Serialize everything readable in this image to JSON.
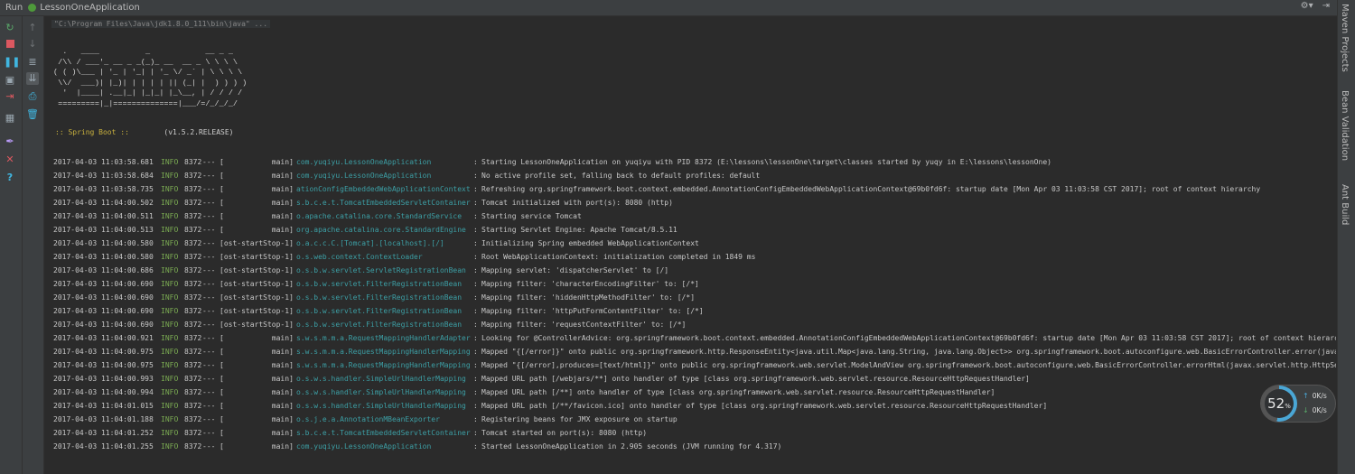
{
  "title_bar": {
    "run_label": "Run",
    "app_name": "LessonOneApplication"
  },
  "right_tabs": [
    "Maven Projects",
    "Bean Validation",
    "Ant Build"
  ],
  "command_line": "\"C:\\Program Files\\Java\\jdk1.8.0_111\\bin\\java\" ...",
  "banner": "  .   ____          _            __ _ _\n /\\\\ / ___'_ __ _ _(_)_ __  __ _ \\ \\ \\ \\\n( ( )\\___ | '_ | '_| | '_ \\/ _` | \\ \\ \\ \\\n \\\\/  ___)| |_)| | | | | || (_| |  ) ) ) )\n  '  |____| .__|_| |_|_| |_\\__, | / / / /\n =========|_|==============|___/=/_/_/_/",
  "spring_boot": {
    "label": ":: Spring Boot ::",
    "version": "(v1.5.2.RELEASE)"
  },
  "logs": [
    {
      "ts": "2017-04-03 11:03:58.681",
      "level": "INFO",
      "pid": "8372",
      "thread": "[           main]",
      "logger": "com.yuqiyu.LessonOneApplication",
      "msg": "Starting LessonOneApplication on yuqiyu with PID 8372 (E:\\lessons\\lessonOne\\target\\classes started by yuqy in E:\\lessons\\lessonOne)"
    },
    {
      "ts": "2017-04-03 11:03:58.684",
      "level": "INFO",
      "pid": "8372",
      "thread": "[           main]",
      "logger": "com.yuqiyu.LessonOneApplication",
      "msg": "No active profile set, falling back to default profiles: default"
    },
    {
      "ts": "2017-04-03 11:03:58.735",
      "level": "INFO",
      "pid": "8372",
      "thread": "[           main]",
      "logger": "ationConfigEmbeddedWebApplicationContext",
      "msg": "Refreshing org.springframework.boot.context.embedded.AnnotationConfigEmbeddedWebApplicationContext@69b0fd6f: startup date [Mon Apr 03 11:03:58 CST 2017]; root of context hierarchy"
    },
    {
      "ts": "2017-04-03 11:04:00.502",
      "level": "INFO",
      "pid": "8372",
      "thread": "[           main]",
      "logger": "s.b.c.e.t.TomcatEmbeddedServletContainer",
      "msg": "Tomcat initialized with port(s): 8080 (http)"
    },
    {
      "ts": "2017-04-03 11:04:00.511",
      "level": "INFO",
      "pid": "8372",
      "thread": "[           main]",
      "logger": "o.apache.catalina.core.StandardService",
      "msg": "Starting service Tomcat"
    },
    {
      "ts": "2017-04-03 11:04:00.513",
      "level": "INFO",
      "pid": "8372",
      "thread": "[           main]",
      "logger": "org.apache.catalina.core.StandardEngine",
      "msg": "Starting Servlet Engine: Apache Tomcat/8.5.11"
    },
    {
      "ts": "2017-04-03 11:04:00.580",
      "level": "INFO",
      "pid": "8372",
      "thread": "[ost-startStop-1]",
      "logger": "o.a.c.c.C.[Tomcat].[localhost].[/]",
      "msg": "Initializing Spring embedded WebApplicationContext"
    },
    {
      "ts": "2017-04-03 11:04:00.580",
      "level": "INFO",
      "pid": "8372",
      "thread": "[ost-startStop-1]",
      "logger": "o.s.web.context.ContextLoader",
      "msg": "Root WebApplicationContext: initialization completed in 1849 ms"
    },
    {
      "ts": "2017-04-03 11:04:00.686",
      "level": "INFO",
      "pid": "8372",
      "thread": "[ost-startStop-1]",
      "logger": "o.s.b.w.servlet.ServletRegistrationBean",
      "msg": "Mapping servlet: 'dispatcherServlet' to [/]"
    },
    {
      "ts": "2017-04-03 11:04:00.690",
      "level": "INFO",
      "pid": "8372",
      "thread": "[ost-startStop-1]",
      "logger": "o.s.b.w.servlet.FilterRegistrationBean",
      "msg": "Mapping filter: 'characterEncodingFilter' to: [/*]"
    },
    {
      "ts": "2017-04-03 11:04:00.690",
      "level": "INFO",
      "pid": "8372",
      "thread": "[ost-startStop-1]",
      "logger": "o.s.b.w.servlet.FilterRegistrationBean",
      "msg": "Mapping filter: 'hiddenHttpMethodFilter' to: [/*]"
    },
    {
      "ts": "2017-04-03 11:04:00.690",
      "level": "INFO",
      "pid": "8372",
      "thread": "[ost-startStop-1]",
      "logger": "o.s.b.w.servlet.FilterRegistrationBean",
      "msg": "Mapping filter: 'httpPutFormContentFilter' to: [/*]"
    },
    {
      "ts": "2017-04-03 11:04:00.690",
      "level": "INFO",
      "pid": "8372",
      "thread": "[ost-startStop-1]",
      "logger": "o.s.b.w.servlet.FilterRegistrationBean",
      "msg": "Mapping filter: 'requestContextFilter' to: [/*]"
    },
    {
      "ts": "2017-04-03 11:04:00.921",
      "level": "INFO",
      "pid": "8372",
      "thread": "[           main]",
      "logger": "s.w.s.m.m.a.RequestMappingHandlerAdapter",
      "msg": "Looking for @ControllerAdvice: org.springframework.boot.context.embedded.AnnotationConfigEmbeddedWebApplicationContext@69b0fd6f: startup date [Mon Apr 03 11:03:58 CST 2017]; root of context hierarchy"
    },
    {
      "ts": "2017-04-03 11:04:00.975",
      "level": "INFO",
      "pid": "8372",
      "thread": "[           main]",
      "logger": "s.w.s.m.m.a.RequestMappingHandlerMapping",
      "msg": "Mapped \"{[/error]}\" onto public org.springframework.http.ResponseEntity<java.util.Map<java.lang.String, java.lang.Object>> org.springframework.boot.autoconfigure.web.BasicErrorController.error(javax.s"
    },
    {
      "ts": "2017-04-03 11:04:00.975",
      "level": "INFO",
      "pid": "8372",
      "thread": "[           main]",
      "logger": "s.w.s.m.m.a.RequestMappingHandlerMapping",
      "msg": "Mapped \"{[/error],produces=[text/html]}\" onto public org.springframework.web.servlet.ModelAndView org.springframework.boot.autoconfigure.web.BasicErrorController.errorHtml(javax.servlet.http.HttpServl"
    },
    {
      "ts": "2017-04-03 11:04:00.993",
      "level": "INFO",
      "pid": "8372",
      "thread": "[           main]",
      "logger": "o.s.w.s.handler.SimpleUrlHandlerMapping",
      "msg": "Mapped URL path [/webjars/**] onto handler of type [class org.springframework.web.servlet.resource.ResourceHttpRequestHandler]"
    },
    {
      "ts": "2017-04-03 11:04:00.994",
      "level": "INFO",
      "pid": "8372",
      "thread": "[           main]",
      "logger": "o.s.w.s.handler.SimpleUrlHandlerMapping",
      "msg": "Mapped URL path [/**] onto handler of type [class org.springframework.web.servlet.resource.ResourceHttpRequestHandler]"
    },
    {
      "ts": "2017-04-03 11:04:01.015",
      "level": "INFO",
      "pid": "8372",
      "thread": "[           main]",
      "logger": "o.s.w.s.handler.SimpleUrlHandlerMapping",
      "msg": "Mapped URL path [/**/favicon.ico] onto handler of type [class org.springframework.web.servlet.resource.ResourceHttpRequestHandler]"
    },
    {
      "ts": "2017-04-03 11:04:01.188",
      "level": "INFO",
      "pid": "8372",
      "thread": "[           main]",
      "logger": "o.s.j.e.a.AnnotationMBeanExporter",
      "msg": "Registering beans for JMX exposure on startup"
    },
    {
      "ts": "2017-04-03 11:04:01.252",
      "level": "INFO",
      "pid": "8372",
      "thread": "[           main]",
      "logger": "s.b.c.e.t.TomcatEmbeddedServletContainer",
      "msg": "Tomcat started on port(s): 8080 (http)"
    },
    {
      "ts": "2017-04-03 11:04:01.255",
      "level": "INFO",
      "pid": "8372",
      "thread": "[           main]",
      "logger": "com.yuqiyu.LessonOneApplication",
      "msg": "Started LessonOneApplication in 2.905 seconds (JVM running for 4.317)"
    }
  ],
  "net_widget": {
    "percent": "52",
    "percent_sign": "%",
    "up": "0K/s",
    "down": "0K/s",
    "fraction": 0.52
  },
  "colors": {
    "info": "#7aaa52",
    "logger": "#3c9fa5",
    "spring_boot": "#c9b13e",
    "gauge": "#4aa7d6"
  },
  "icons": {
    "toolbar1": [
      "rerun-icon",
      "stop-icon",
      "pause-icon",
      "dump-threads-icon",
      "exit-icon",
      "layout-icon",
      "pin-icon",
      "close-icon",
      "help-icon"
    ],
    "toolbar2": [
      "up-arrow-icon",
      "down-arrow-icon",
      "soft-wrap-icon",
      "scroll-to-end-icon",
      "print-icon",
      "trash-icon"
    ]
  }
}
